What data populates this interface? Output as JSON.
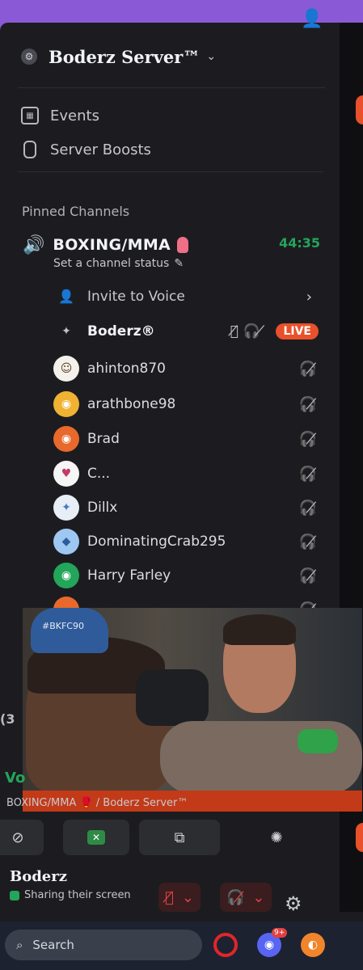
{
  "server": {
    "name": "Boderz Server™"
  },
  "nav": [
    {
      "label": "Events",
      "icon": "calendar-icon"
    },
    {
      "label": "Server Boosts",
      "icon": "boost-icon"
    }
  ],
  "pinned": {
    "section_label": "Pinned Channels",
    "channel_name": "BOXING/MMA",
    "timer": "44:35",
    "status_text": "Set a channel status"
  },
  "invite": {
    "label": "Invite to Voice"
  },
  "host": {
    "name": "Boderz®",
    "live": "LIVE"
  },
  "users": [
    {
      "name": "ahinton870",
      "color": "#f3f1ea",
      "glyph": "☺"
    },
    {
      "name": "arathbone98",
      "color": "#f0b232",
      "glyph": "◉"
    },
    {
      "name": "Brad",
      "color": "#e8692b",
      "glyph": "◉"
    },
    {
      "name": "C...",
      "color": "#f5f5f5",
      "glyph": "♥"
    },
    {
      "name": "Dillx",
      "color": "#e8eef6",
      "glyph": "✦"
    },
    {
      "name": "DominatingCrab295",
      "color": "#9ec8f2",
      "glyph": "◆"
    },
    {
      "name": "Harry Farley",
      "color": "#23a55a",
      "glyph": "◉"
    }
  ],
  "stream": {
    "cap_text": "#BKFC90",
    "breadcrumb": "BOXING/MMA 🥊 / Boderz Server™",
    "left_fragment": "(3",
    "vo_fragment": "Vo"
  },
  "panel": {
    "name": "Boderz",
    "status": "Sharing their screen"
  },
  "taskbar": {
    "search_label": "Search",
    "discord_badge": "9+"
  }
}
